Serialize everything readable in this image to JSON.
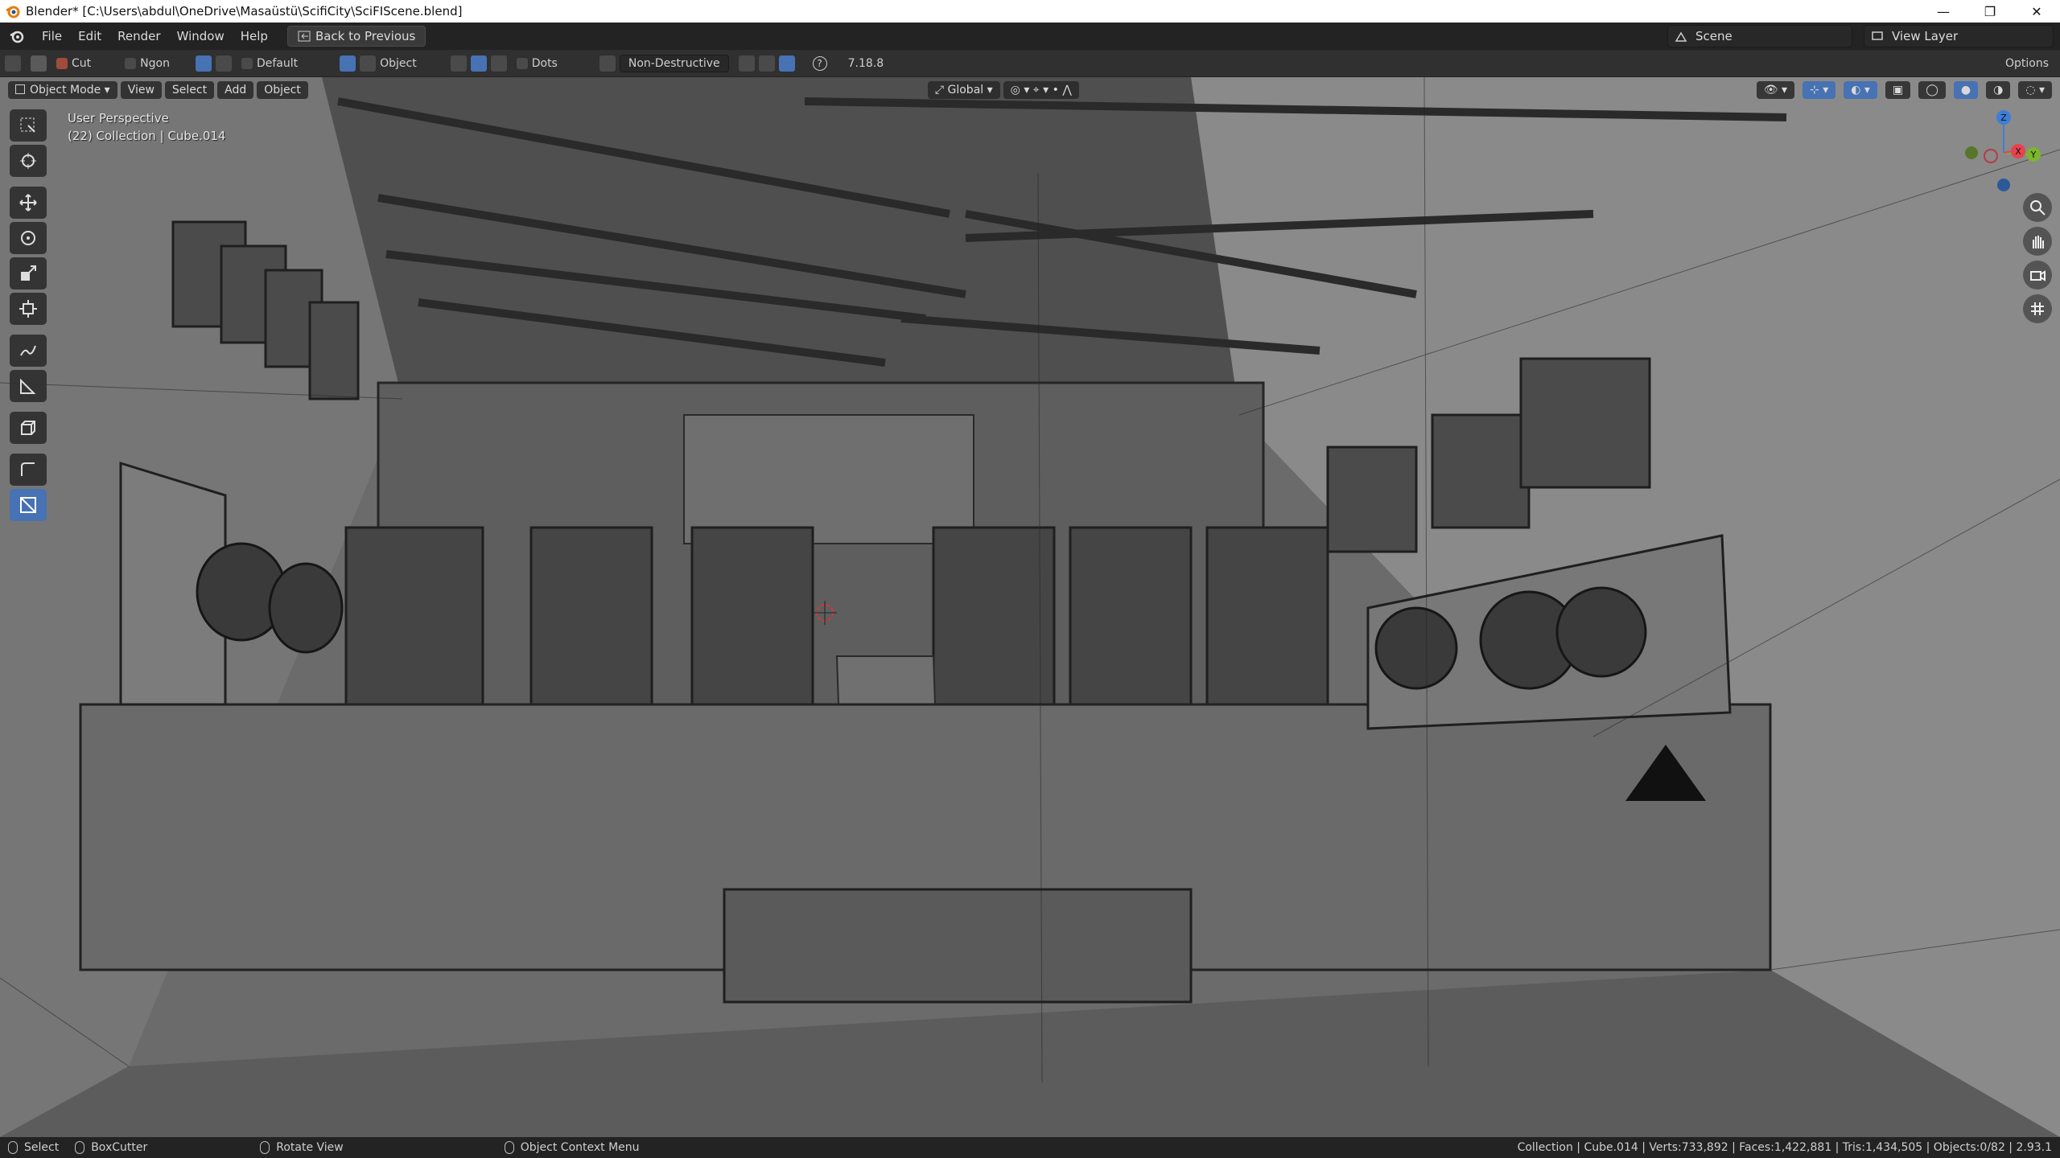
{
  "window": {
    "title": "Blender* [C:\\Users\\abdul\\OneDrive\\Masaüstü\\ScifiCity\\SciFIScene.blend]",
    "minimize": "—",
    "maximize": "❐",
    "close": "✕"
  },
  "menubar": {
    "items": [
      "File",
      "Edit",
      "Render",
      "Window",
      "Help"
    ],
    "back_label": "Back to Previous",
    "scene_label": "Scene",
    "view_layer_label": "View Layer"
  },
  "tool_header": {
    "cut_label": "Cut",
    "ngon_label": "Ngon",
    "default_label": "Default",
    "object_label": "Object",
    "dots_label": "Dots",
    "nondestructive_label": "Non-Destructive",
    "version_label": "7.18.8",
    "options_label": "Options"
  },
  "viewport_header": {
    "mode_label": "Object Mode",
    "view_label": "View",
    "select_label": "Select",
    "add_label": "Add",
    "object_label": "Object",
    "orientation_label": "Global"
  },
  "overlay": {
    "perspective": "User Perspective",
    "collection": "(22) Collection | Cube.014"
  },
  "gizmo": {
    "x": "X",
    "y": "Y",
    "z": "Z",
    "x_color": "#e8424e",
    "y_color": "#7eb52e",
    "z_color": "#3d7ed6"
  },
  "statusbar": {
    "select": "Select",
    "boxcutter": "BoxCutter",
    "rotate": "Rotate View",
    "context": "Object Context Menu",
    "stats": "Collection | Cube.014 | Verts:733,892 | Faces:1,422,881 | Tris:1,434,505 | Objects:0/82 | 2.93.1"
  },
  "colors": {
    "accent": "#4772b3",
    "ui_dark": "#232323",
    "header": "#303030",
    "viewport_bg": "#6b6b6b"
  }
}
